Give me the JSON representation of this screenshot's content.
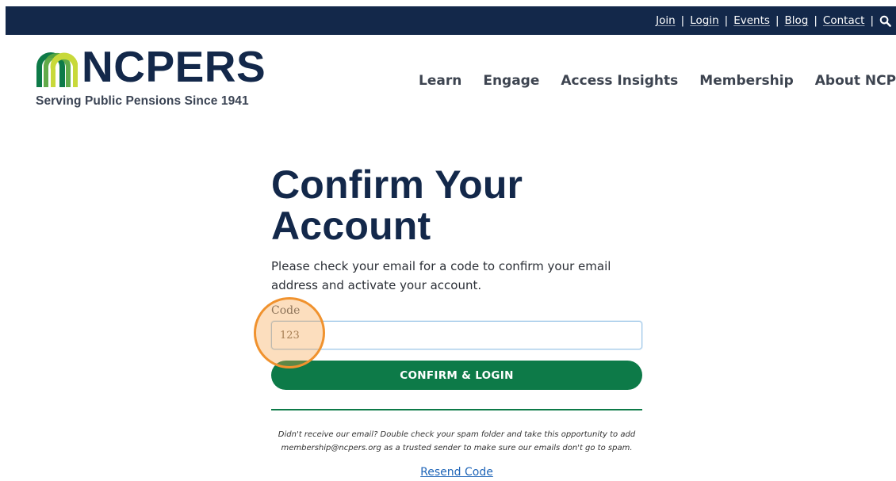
{
  "top_bar": {
    "links": [
      "Join",
      "Login",
      "Events",
      "Blog",
      "Contact"
    ],
    "separator": "|",
    "search_icon": "search-icon"
  },
  "logo": {
    "name": "NCPERS",
    "tagline": "Serving Public Pensions Since 1941",
    "mark_colors": [
      "#0d7a48",
      "#5aa640",
      "#c8d93a"
    ]
  },
  "nav": {
    "items": [
      "Learn",
      "Engage",
      "Access Insights",
      "Membership",
      "About NCPERS"
    ]
  },
  "main": {
    "title": "Confirm Your Account",
    "intro": "Please check your email for a code to confirm your email address and activate your account.",
    "code_label": "Code",
    "code_placeholder": "123",
    "code_value": "",
    "confirm_button": "CONFIRM & LOGIN",
    "help_text_line1": "Didn't receive our email? Double check your spam folder and take this opportunity to add",
    "help_text_line2": "membership@ncpers.org as a trusted sender to make sure our emails don't go to spam.",
    "resend_link": "Resend Code"
  },
  "colors": {
    "navy": "#13284a",
    "green": "#0d7a48",
    "link_blue": "#2066b8",
    "highlight": "#f0922e"
  }
}
